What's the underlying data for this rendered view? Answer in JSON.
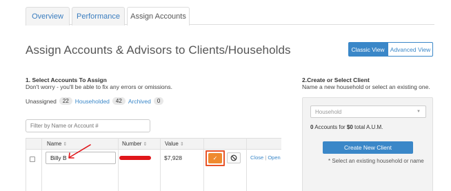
{
  "tabs": [
    {
      "label": "Overview"
    },
    {
      "label": "Performance"
    },
    {
      "label": "Assign Accounts"
    }
  ],
  "page": {
    "title": "Assign Accounts & Advisors to Clients/Households"
  },
  "view_toggle": {
    "classic": "Classic View",
    "advanced": "Advanced View"
  },
  "step1": {
    "title": "1. Select Accounts To Assign",
    "subtitle": "Don't worry - you'll be able to fix any errors or omissions."
  },
  "filters": {
    "unassigned_label": "Unassigned",
    "unassigned_count": "22",
    "householded_label": "Householded",
    "householded_count": "42",
    "archived_label": "Archived",
    "archived_count": "0"
  },
  "search": {
    "placeholder": "Filter by Name or Account #"
  },
  "table": {
    "columns": [
      "Name",
      "Number",
      "Value"
    ],
    "sort_icon": "⇕",
    "rows": [
      {
        "name": "Billy B",
        "value": "$7,928",
        "close": "Close",
        "open": "Open"
      }
    ]
  },
  "step2": {
    "title": "2.Create or Select Client",
    "subtitle": "Name a new household or select an existing one."
  },
  "client_panel": {
    "select_placeholder": "Household",
    "aum_count": "0",
    "aum_mid": " Accounts for ",
    "aum_amount": "$0",
    "aum_end": " total A.U.M.",
    "create_button": "Create New Client",
    "hint": "* Select an existing household or name"
  },
  "colors": {
    "accent": "#3a87c8",
    "confirm": "#ef8a2f",
    "annotation": "#e8542a"
  }
}
